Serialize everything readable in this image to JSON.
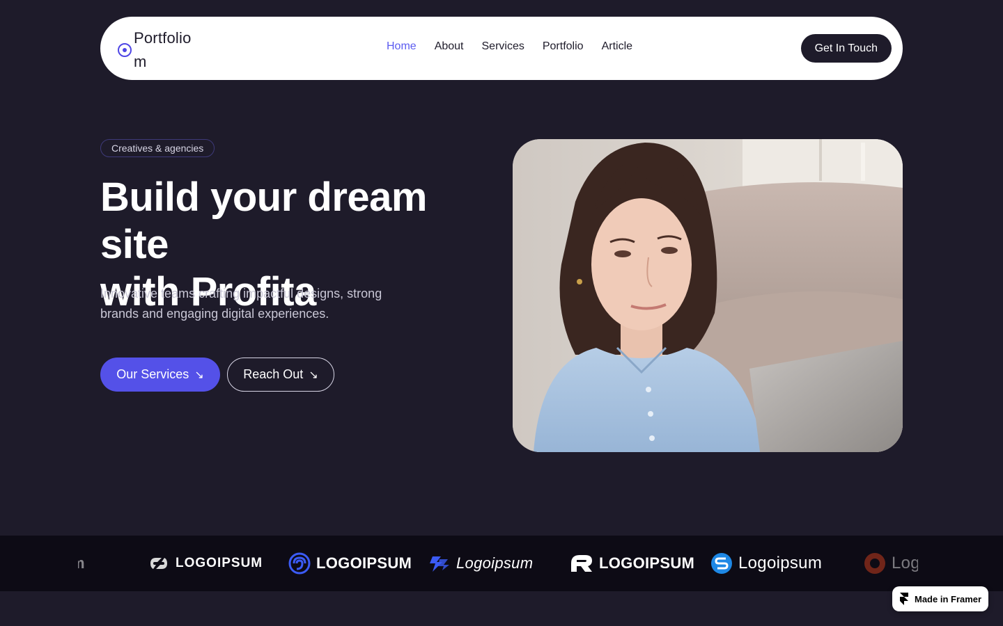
{
  "nav": {
    "logo_text": "Portfolio m",
    "links": [
      {
        "label": "Home",
        "active": true
      },
      {
        "label": "About",
        "active": false
      },
      {
        "label": "Services",
        "active": false
      },
      {
        "label": "Portfolio",
        "active": false
      },
      {
        "label": "Article",
        "active": false
      }
    ],
    "cta_label": "Get In Touch"
  },
  "hero": {
    "badge": "Creatives & agencies",
    "headline_line1": "Build your dream site",
    "headline_line2": "with Profita",
    "subtext": "Innovative teams crafting impactful designs, strong brands and engaging digital experiences.",
    "primary_button": "Our Services",
    "secondary_button": "Reach Out",
    "button_arrow": "↘"
  },
  "logos": [
    {
      "text": "psum",
      "icon": "logo-partial-icon"
    },
    {
      "text": "LOGOIPSUM",
      "icon": "chain-logo-icon"
    },
    {
      "text": "LOGOIPSUM",
      "icon": "swirl-logo-icon"
    },
    {
      "text": "Logoipsum",
      "icon": "bolt-logo-icon"
    },
    {
      "text": "LOGOIPSUM",
      "icon": "r-logo-icon"
    },
    {
      "text": "Logoipsum",
      "icon": "s-circle-logo-icon"
    },
    {
      "text": "Log",
      "icon": "ring-logo-icon"
    }
  ],
  "framer_badge": "Made in Framer",
  "colors": {
    "background": "#1e1b2a",
    "accent": "#5451e8",
    "nav_bg": "#ffffff",
    "strip_bg": "#0d0b15"
  }
}
